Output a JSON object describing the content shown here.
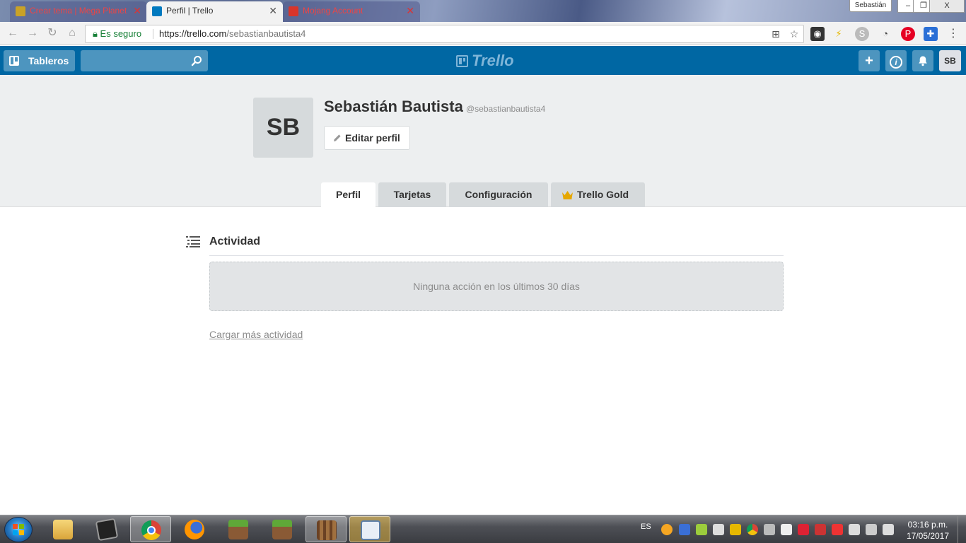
{
  "browser": {
    "tabs": [
      {
        "title": "Crear tema | Mega Planet",
        "favicon_color": "#c9a227"
      },
      {
        "title": "Perfil | Trello",
        "favicon_color": "#0079bf"
      },
      {
        "title": "Mojang Account",
        "favicon_color": "#d9352b"
      }
    ],
    "user": "Sebastián",
    "window_buttons": {
      "minimize": "–",
      "restore": "❐",
      "close": "X"
    },
    "secure_label": "Es seguro",
    "url_host": "https://trello.com",
    "url_path": "/sebastianbautista4"
  },
  "trello": {
    "boards_label": "Tableros",
    "logo_text": "Trello",
    "add_symbol": "+",
    "info_symbol": "i",
    "avatar_initials": "SB"
  },
  "profile": {
    "initials": "SB",
    "full_name": "Sebastián Bautista",
    "username": "@sebastianbautista4",
    "edit_label": "Editar perfil",
    "tabs": [
      "Perfil",
      "Tarjetas",
      "Configuración",
      "Trello Gold"
    ]
  },
  "activity": {
    "title": "Actividad",
    "empty_message": "Ninguna acción en los últimos 30 días",
    "load_more": "Cargar más actividad"
  },
  "taskbar": {
    "language": "ES",
    "time": "03:16 p.m.",
    "date": "17/05/2017"
  },
  "colors": {
    "trello_blue": "#0067a3",
    "header_button": "#4d95bf",
    "gold": "#e6a700"
  }
}
